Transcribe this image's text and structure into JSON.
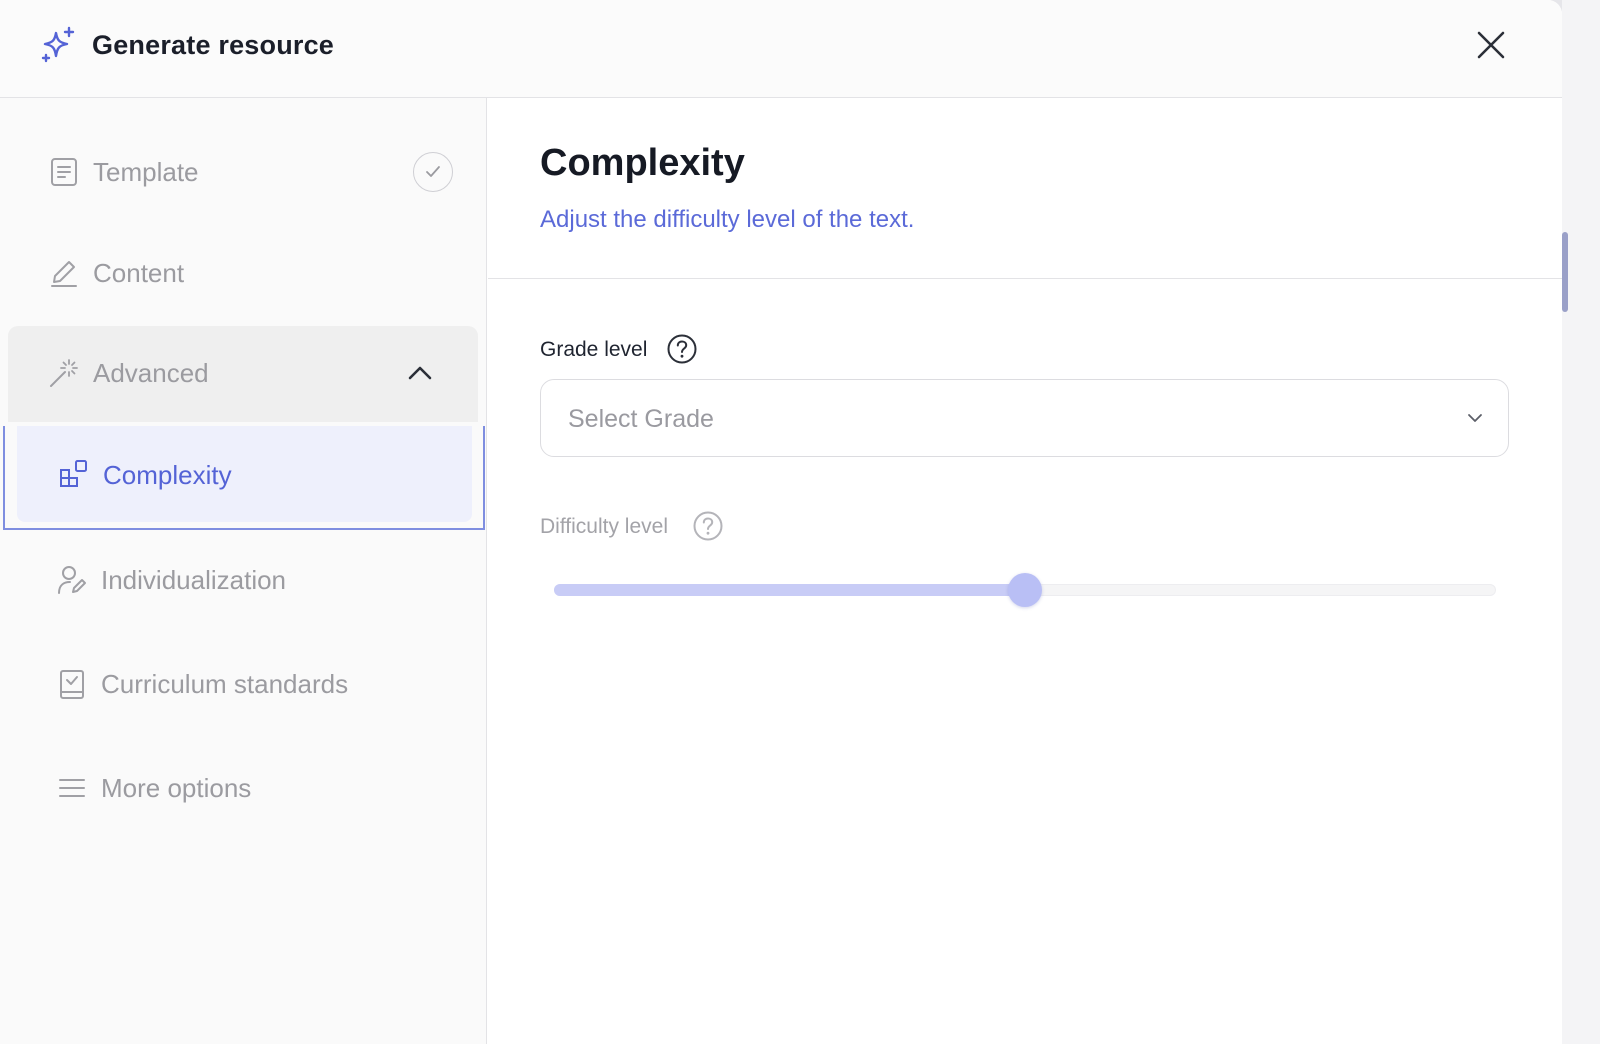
{
  "header": {
    "title": "Generate resource",
    "icon": "sparkle-icon",
    "close_icon": "close-icon"
  },
  "sidebar": {
    "items": [
      {
        "label": "Template",
        "icon": "document-icon",
        "completed": true
      },
      {
        "label": "Content",
        "icon": "pencil-icon"
      },
      {
        "label": "Advanced",
        "icon": "magic-wand-icon",
        "expanded": true
      }
    ],
    "advanced_items": [
      {
        "label": "Complexity",
        "icon": "blocks-icon",
        "active": true
      },
      {
        "label": "Individualization",
        "icon": "user-edit-icon"
      },
      {
        "label": "Curriculum standards",
        "icon": "checklist-book-icon"
      },
      {
        "label": "More options",
        "icon": "menu-lines-icon"
      }
    ]
  },
  "main": {
    "title": "Complexity",
    "subtitle": "Adjust the difficulty level of the text.",
    "grade": {
      "label": "Grade level",
      "placeholder": "Select Grade"
    },
    "difficulty": {
      "label": "Difficulty level",
      "value_fraction": 0.5
    }
  },
  "colors": {
    "accent": "#5463d6",
    "active_bg": "#eef0fc",
    "slider_fill": "#c8ccf6",
    "muted_text": "#9b9ba0"
  }
}
